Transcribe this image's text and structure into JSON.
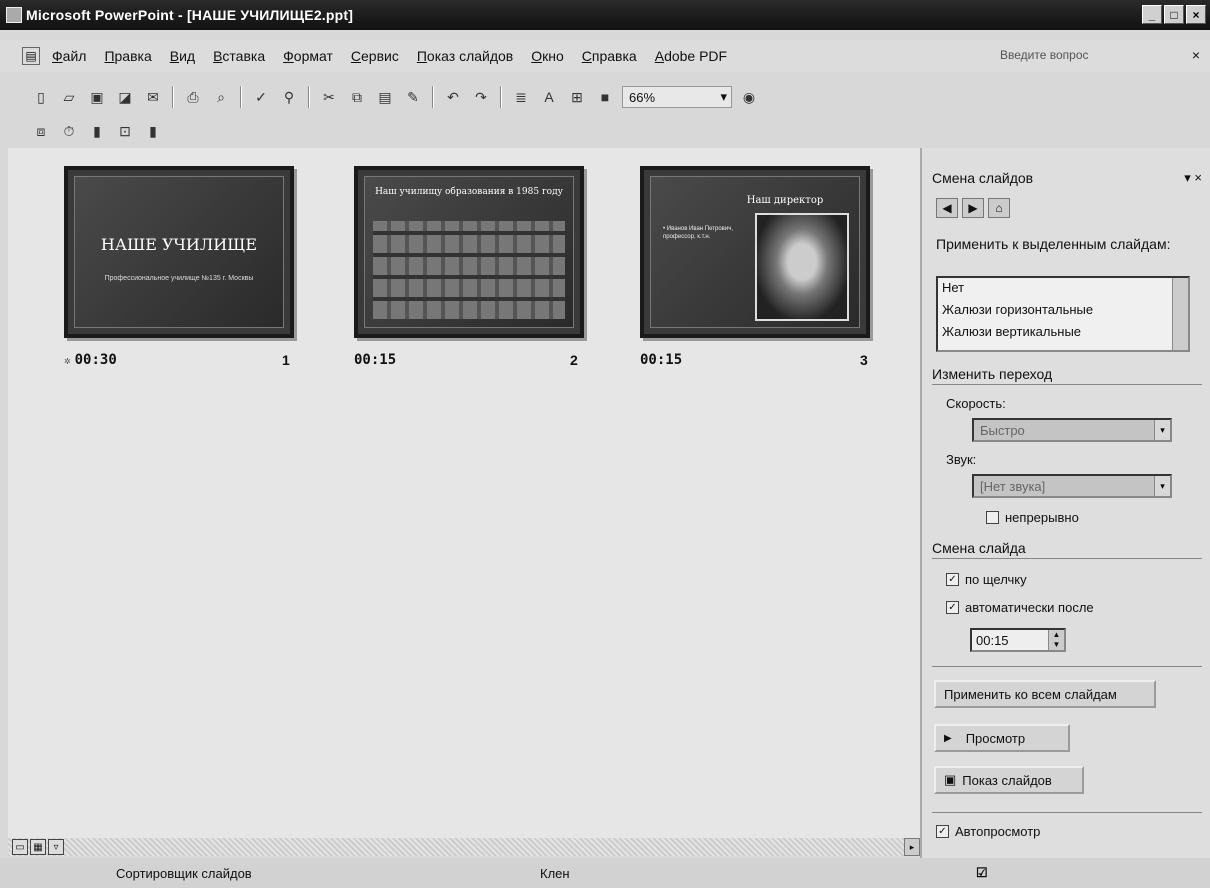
{
  "window": {
    "title": "Microsoft PowerPoint - [НАШЕ УЧИЛИЩЕ2.ppt]",
    "controls": [
      "_",
      "□",
      "×"
    ]
  },
  "menu": {
    "items": [
      "Файл",
      "Правка",
      "Вид",
      "Вставка",
      "Формат",
      "Сервис",
      "Показ слайдов",
      "Окно",
      "Справка",
      "Adobe PDF"
    ],
    "help_placeholder": "Введите вопрос",
    "close": "×"
  },
  "toolbar": {
    "zoom": "66%"
  },
  "slides": [
    {
      "title": "НАШЕ УЧИЛИЩЕ",
      "subtitle": "Профессиональное училище №135 г. Москвы",
      "time": "00:30",
      "number": "1"
    },
    {
      "title": "Наш училищу образования в 1985 году",
      "time": "00:15",
      "number": "2"
    },
    {
      "title": "Наш директор",
      "bullets": "• Иванов Иван Петрович, профессор, к.т.н.",
      "time": "00:15",
      "number": "3"
    }
  ],
  "status": {
    "view": "Сортировщик слайдов",
    "design": "Клен"
  },
  "taskpane": {
    "title": "Смена слайдов",
    "apply_label": "Применить к выделенным слайдам:",
    "transitions": [
      "Нет",
      "Жалюзи горизонтальные",
      "Жалюзи вертикальные"
    ],
    "modify_header": "Изменить переход",
    "speed_label": "Скорость:",
    "speed_value": "Быстро",
    "sound_label": "Звук:",
    "sound_value": "[Нет звука]",
    "loop_label": "непрерывно",
    "advance_header": "Смена слайда",
    "on_click_label": "по щелчку",
    "auto_label": "автоматически после",
    "auto_time": "00:15",
    "apply_all": "Применить ко всем слайдам",
    "preview": "Просмотр",
    "slideshow": "Показ слайдов",
    "autopreview": "Автопросмотр"
  }
}
